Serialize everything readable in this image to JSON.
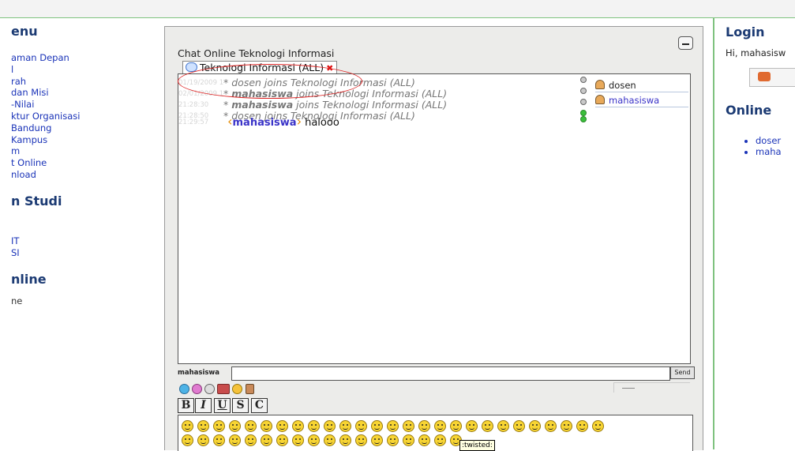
{
  "left_sidebar": {
    "menu_heading": "enu",
    "menu_items": [
      "aman Depan",
      "l",
      "rah",
      "dan Misi",
      "-Nilai",
      "ktur Organisasi",
      "Bandung",
      "Kampus",
      "m",
      "t Online",
      "nload"
    ],
    "studi_heading": "n Studi",
    "studi_items": [
      "IT",
      "SI"
    ],
    "online_heading": "nline",
    "online_text": "ne"
  },
  "chat": {
    "title": "Chat Online Teknologi Informasi",
    "tab_label": "Teknologi Informasi (ALL)",
    "messages": [
      {
        "time": "01/19/2009 12:54:38",
        "prefix": "* ",
        "user": "dosen",
        "text": " joins Teknologi Informasi (ALL)",
        "bold": false,
        "status": "gray"
      },
      {
        "time": "02/01/2009 18:03:25",
        "prefix": "* ",
        "user": "mahasiswa",
        "text": " joins Teknologi Informasi (ALL)",
        "bold": true,
        "status": "gray"
      },
      {
        "time": "21:28:30",
        "prefix": "* ",
        "user": "mahasiswa",
        "text": " joins Teknologi Informasi (ALL)",
        "bold": true,
        "status": "gray"
      },
      {
        "time": "21:28:50",
        "prefix": "* ",
        "user": "dosen",
        "text": " joins Teknologi Informasi (ALL)",
        "bold": false,
        "status": "green"
      }
    ],
    "chat_message": {
      "time": "21:29:57",
      "open": "‹",
      "nick": "mahasiswa",
      "close": "›",
      "text": " halooo",
      "status": "green"
    },
    "users": [
      {
        "name": "dosen",
        "is_me": false
      },
      {
        "name": "mahasiswa",
        "is_me": true
      }
    ],
    "input": {
      "nick_label": "mahasiswa",
      "value": "",
      "send_label": "Send"
    },
    "format_buttons": [
      "B",
      "I",
      "U",
      "S",
      "C"
    ],
    "tool_icons": [
      "smiley-menu-icon",
      "color-picker-icon",
      "clock-icon",
      "sound-icon",
      "emoticon-icon",
      "user-icon"
    ],
    "smiley_count_row1": 27,
    "smiley_count_row2": 18,
    "tooltip": ":twisted:"
  },
  "right_sidebar": {
    "login_heading": "Login",
    "login_text": "Hi, mahasisw",
    "online_heading": "Online",
    "online_users": [
      "doser",
      "maha"
    ]
  },
  "colors": {
    "accent_green": "#7fc27f",
    "heading_blue": "#1b3a73",
    "link_blue": "#1a33b8",
    "nick_purple": "#3a33c8",
    "highlight_red": "#d22222"
  }
}
